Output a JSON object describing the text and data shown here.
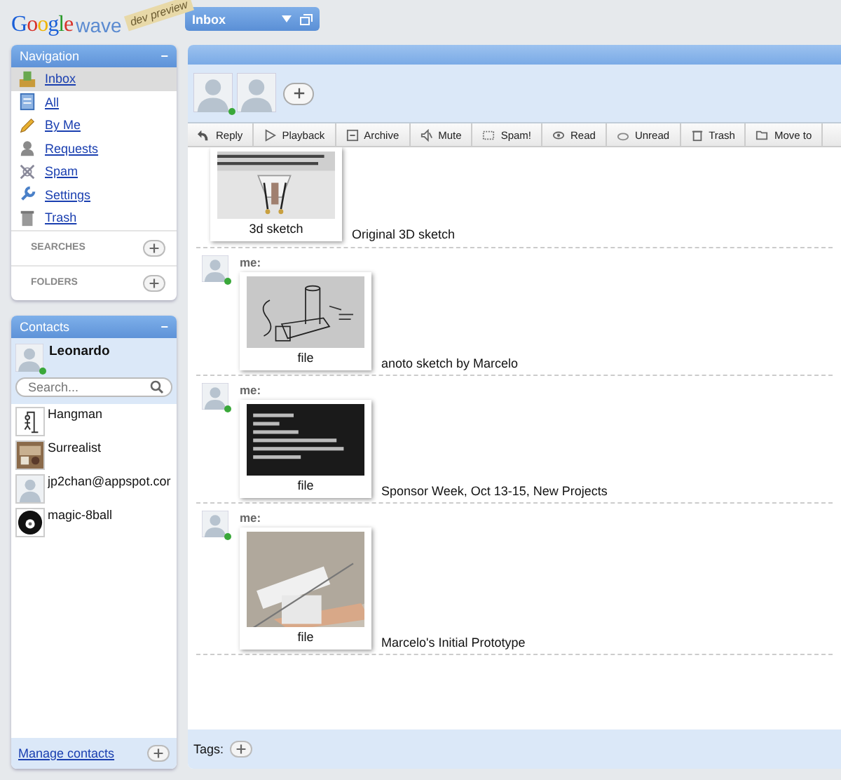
{
  "logo": {
    "brand": "Google",
    "product": "wave",
    "badge": "dev preview"
  },
  "inbox_button": {
    "label": "Inbox",
    "expanded": false
  },
  "navigation": {
    "title": "Navigation",
    "collapse": "−",
    "items": [
      {
        "label": "Inbox",
        "selected": true
      },
      {
        "label": "All",
        "selected": false
      },
      {
        "label": "By Me",
        "selected": false
      },
      {
        "label": "Requests",
        "selected": false
      },
      {
        "label": "Spam",
        "selected": false
      },
      {
        "label": "Settings",
        "selected": false
      },
      {
        "label": "Trash",
        "selected": false
      }
    ],
    "sections": [
      {
        "label": "SEARCHES"
      },
      {
        "label": "FOLDERS"
      }
    ]
  },
  "contacts": {
    "title": "Contacts",
    "collapse": "−",
    "me": {
      "name": "Leonardo",
      "online": true
    },
    "search": {
      "placeholder": "Search..."
    },
    "items": [
      {
        "name": "Hangman"
      },
      {
        "name": "Surrealist"
      },
      {
        "name": "jp2chan@appspot.cor"
      },
      {
        "name": "magic-8ball"
      }
    ],
    "manage": "Manage contacts"
  },
  "wave": {
    "participants": [
      {
        "online": true
      },
      {
        "online": false
      }
    ],
    "toolbar": [
      "Reply",
      "Playback",
      "Archive",
      "Mute",
      "Spam!",
      "Read",
      "Unread",
      "Trash",
      "Move to"
    ],
    "blips": [
      {
        "caption": "3d sketch",
        "text": "Original 3D sketch"
      },
      {
        "author": "me:",
        "online": true,
        "caption": "file",
        "text": "anoto sketch by Marcelo"
      },
      {
        "author": "me:",
        "online": true,
        "caption": "file",
        "text": "Sponsor Week, Oct 13-15, New Projects"
      },
      {
        "author": "me:",
        "online": true,
        "caption": "file",
        "text": "Marcelo's Initial Prototype"
      }
    ],
    "tags_label": "Tags:"
  }
}
